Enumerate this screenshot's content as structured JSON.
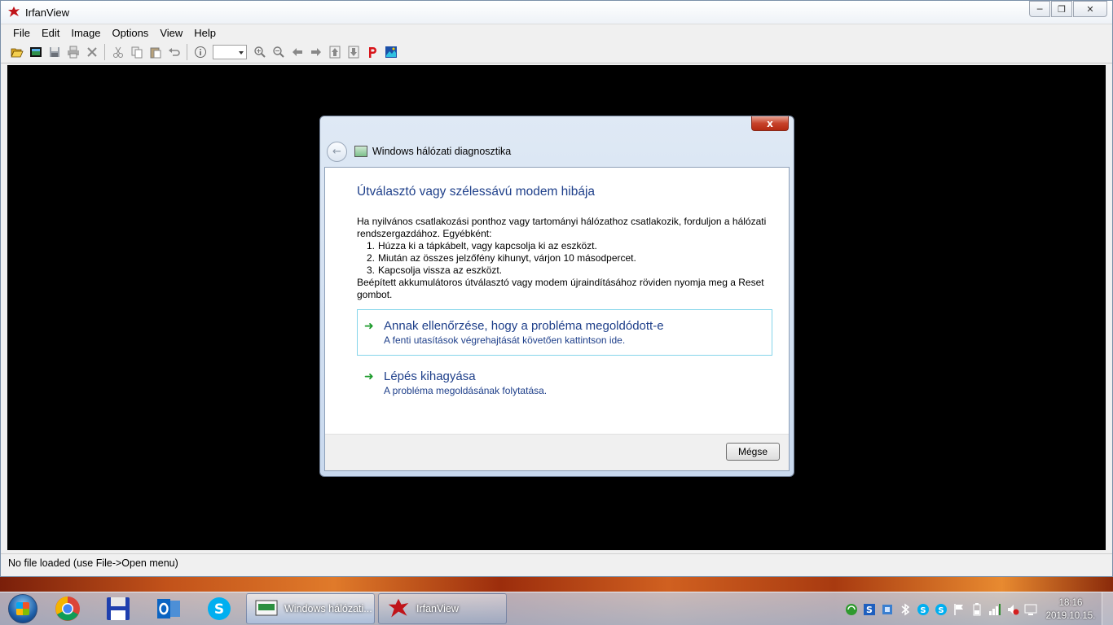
{
  "window": {
    "title": "IrfanView",
    "controls": [
      "minimize-icon",
      "maximize-icon",
      "close-icon"
    ]
  },
  "menu": [
    "File",
    "Edit",
    "Image",
    "Options",
    "View",
    "Help"
  ],
  "toolbar": {
    "icons": [
      "open-icon",
      "slideshow-icon",
      "save-icon",
      "print-icon",
      "delete-icon",
      "cut-icon",
      "copy-icon",
      "paste-icon",
      "undo-icon",
      "info-icon",
      "zoom-combo",
      "zoom-in-icon",
      "zoom-out-icon",
      "previous-icon",
      "next-icon",
      "first-icon",
      "last-icon",
      "paint-icon",
      "about-icon"
    ],
    "zoom_value": ""
  },
  "status": {
    "text": "No file loaded (use File->Open menu)"
  },
  "dialog": {
    "title": "Windows hálózati diagnosztika",
    "close_label": "x",
    "heading": "Útválasztó vagy szélessávú modem hibája",
    "intro": "Ha nyilvános csatlakozási ponthoz vagy tartományi hálózathoz csatlakozik, forduljon a hálózati rendszergazdához. Egyébként:",
    "steps": [
      {
        "num": "1.",
        "text": "Húzza ki a tápkábelt, vagy kapcsolja ki az eszközt."
      },
      {
        "num": "2.",
        "text": "Miután az összes jelzőfény kihunyt, várjon 10 másodpercet."
      },
      {
        "num": "3.",
        "text": "Kapcsolja vissza az eszközt."
      }
    ],
    "outro": "Beépített akkumulátoros útválasztó vagy modem újraindításához röviden nyomja meg a Reset gombot.",
    "options": [
      {
        "title": "Annak ellenőrzése, hogy a probléma megoldódott-e",
        "subtitle": "A fenti utasítások végrehajtását követően kattintson ide."
      },
      {
        "title": "Lépés kihagyása",
        "subtitle": "A probléma megoldásának folytatása."
      }
    ],
    "cancel_label": "Mégse"
  },
  "taskbar": {
    "pinned": [
      "chrome-icon",
      "save-disk-icon",
      "outlook-icon",
      "skype-icon"
    ],
    "tasks": [
      {
        "label": "Windows hálózati...",
        "icon": "network-diagnostics-icon"
      },
      {
        "label": "IrfanView",
        "icon": "irfanview-icon"
      }
    ],
    "tray_icons": [
      "sync-icon",
      "s-app-icon",
      "network-app-icon",
      "bluetooth-icon",
      "skype-tray-icon",
      "skype-tray-icon-2",
      "flag-icon",
      "battery-icon",
      "signal-icon",
      "volume-muted-icon",
      "display-icon"
    ],
    "time": "18:16",
    "date": "2019.10.15."
  },
  "colors": {
    "heading": "#1e3f8a",
    "arrow": "#1b9a2a",
    "canvas": "#000000"
  }
}
